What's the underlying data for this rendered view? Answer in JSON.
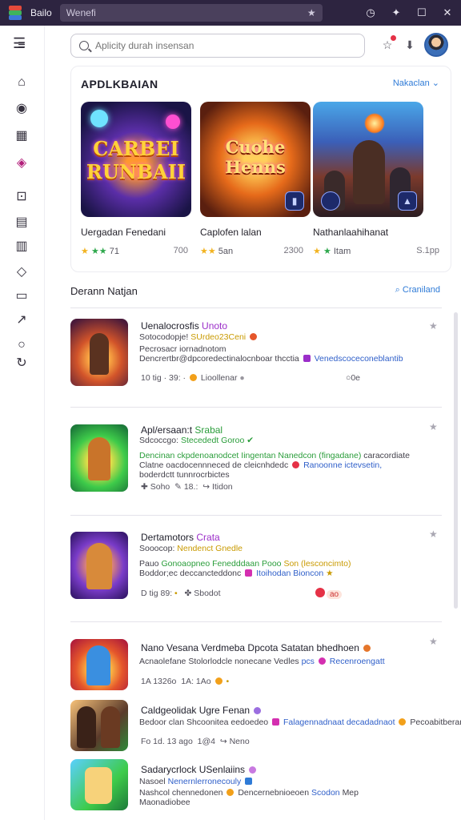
{
  "titlebar": {
    "app_name": "Bailo",
    "address": "Wenefi"
  },
  "search": {
    "placeholder": "Aplicity durah insensan"
  },
  "featured": {
    "title": "APDLKBAIAN",
    "more_label": "Nakaclan",
    "tiles": [
      {
        "art_text": "CARBEI RUNBAII",
        "name": "Uergadan Fenedani",
        "rating": "71",
        "count": "700"
      },
      {
        "art_text": "Cuohe Henns",
        "name": "Caplofen lalan",
        "rating": "5an",
        "count": "2300"
      },
      {
        "art_text": "",
        "name": "Nathanlaahihanat",
        "rating": "Itam",
        "count": "S.1pp"
      }
    ]
  },
  "section": {
    "title": "Derann Natjan",
    "link": "Craniland"
  },
  "rows": [
    {
      "title": "Uenalocrosfis",
      "title_tag": "Unoto",
      "sub1_a": "Sotocodopje!",
      "sub1_b": "SUrdeo23Ceni",
      "sub2": "Pecrosacr iornadnotom",
      "sub3_a": "Dencrertbr@dpcoredectinalocnboar thcctia",
      "sub3_b": "Venedscoceconeblantib",
      "meta_a": "10 tig",
      "meta_b": "39:",
      "meta_c": "Lioollenar",
      "meta_d": "0e"
    },
    {
      "title": "Apl/ersaan:t",
      "title_tag": "Srabal",
      "sub1_a": "Sdcoccgo:",
      "sub1_b": "Stecededt Goroo",
      "sub2_a": "Dencinan ckpdenoanodcet",
      "sub2_b": "Iingentan Nanedcon (fingadane)",
      "sub2_c": "caracordiate",
      "sub3_a": "Clatne oacdocennneced de",
      "sub3_b": "cleicnhdedc",
      "sub3_c": "Ranoonne ictevsetin,",
      "sub4": "boderdctt tunnrocrbictes",
      "meta_a": "Soho",
      "meta_b": "18.:",
      "meta_c": "Itidon"
    },
    {
      "title": "Dertamotors",
      "title_tag": "Crata",
      "sub1_a": "Sooocop:",
      "sub1_b": "Nendenct Gnedle",
      "sub2_a": "Pauo",
      "sub2_b": "Gonoaopneo Fenedddaan Pooo",
      "sub2_c": "Son (lesconcimto)",
      "sub3_a": "Boddor;ec deccancteddonc",
      "sub3_b": "Itoihodan Bioncon",
      "meta_a": "D tig",
      "meta_b": "89:",
      "meta_c": "Sbodot",
      "meta_d": "ao"
    },
    {
      "title": "Nano Vesana Verdmeba Dpcota Satatan bhedhoen",
      "sub1_a": "Acnaolefane",
      "sub1_b": "Stolorlodcle nonecane Vedles",
      "sub1_c": "pcs",
      "sub1_d": "Recenroengatt",
      "meta_a": "1A",
      "meta_b": "1326o",
      "meta_c": "1A:",
      "meta_d": "1Ao"
    },
    {
      "title": "Caldgeolidak Ugre Fenan",
      "sub1_a": "Bedoor clan Shcoonitea",
      "sub1_b": "eedoedeo",
      "sub1_c": "Falagennadnaat",
      "sub1_d": "decadadnaot",
      "sub1_e": "Pecoabitberan",
      "meta_a": "Fo 1d. 13 ago",
      "meta_b": "1@4",
      "meta_c": "Neno"
    },
    {
      "title": "Sadarycrlock USenlaiins",
      "sub1_a": "Nasoel",
      "sub1_b": "Nenernlerronecouly",
      "sub2_a": "Nashcol chennedonen",
      "sub2_b": "Dencernebnioeoen",
      "sub2_c": "Scodon",
      "sub2_d": "Mep",
      "sub3": "Maonadiobee"
    }
  ]
}
